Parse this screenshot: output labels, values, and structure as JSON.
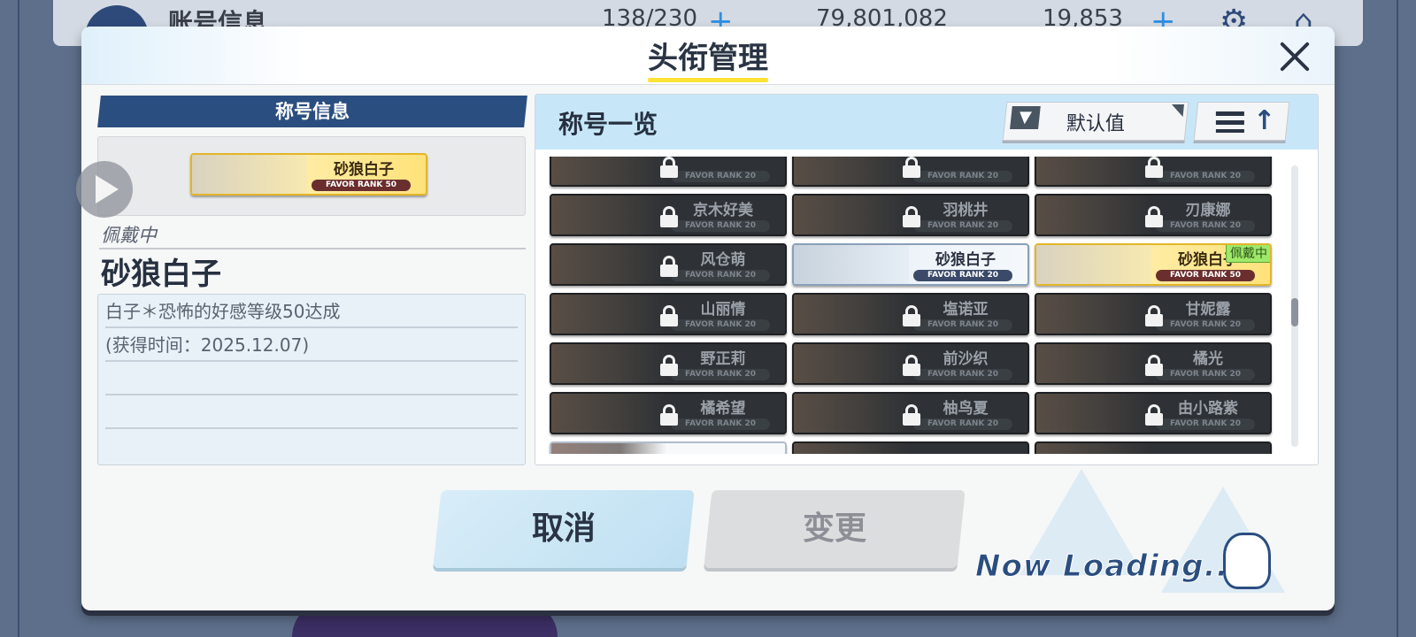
{
  "background": {
    "screen_title": "账号信息",
    "resources": [
      {
        "name": "ap",
        "value": "138/230"
      },
      {
        "name": "credits",
        "value": "79,801,082"
      },
      {
        "name": "gems",
        "value": "19,853"
      }
    ]
  },
  "modal": {
    "title": "头衔管理",
    "close_icon": "close-icon"
  },
  "left": {
    "header": "称号信息",
    "preview": {
      "name": "砂狼白子",
      "rank": "FAVOR RANK 50"
    },
    "equipped_label": "佩戴中",
    "equipped_name": "砂狼白子",
    "description_lines": [
      "白子＊恐怖的好感等级50达成",
      "(获得时间：2025.12.07)"
    ]
  },
  "right": {
    "title": "称号一览",
    "filter_label": "默认值",
    "equipped_badge": "佩戴中",
    "tiles": [
      {
        "name": "",
        "rank": "FAVOR RANK 20",
        "state": "locked"
      },
      {
        "name": "",
        "rank": "FAVOR RANK 20",
        "state": "locked"
      },
      {
        "name": "",
        "rank": "FAVOR RANK 20",
        "state": "locked"
      },
      {
        "name": "京木好美",
        "rank": "FAVOR RANK 20",
        "state": "locked"
      },
      {
        "name": "羽桃井",
        "rank": "FAVOR RANK 20",
        "state": "locked"
      },
      {
        "name": "刃康娜",
        "rank": "FAVOR RANK 20",
        "state": "locked"
      },
      {
        "name": "风仓萌",
        "rank": "FAVOR RANK 20",
        "state": "locked"
      },
      {
        "name": "砂狼白子",
        "rank": "FAVOR RANK 20",
        "state": "unlocked"
      },
      {
        "name": "砂狼白子",
        "rank": "FAVOR RANK 50",
        "state": "equipped"
      },
      {
        "name": "山丽情",
        "rank": "FAVOR RANK 20",
        "state": "locked"
      },
      {
        "name": "塩诺亚",
        "rank": "FAVOR RANK 20",
        "state": "locked"
      },
      {
        "name": "甘妮露",
        "rank": "FAVOR RANK 20",
        "state": "locked"
      },
      {
        "name": "野正莉",
        "rank": "FAVOR RANK 20",
        "state": "locked"
      },
      {
        "name": "前沙织",
        "rank": "FAVOR RANK 20",
        "state": "locked"
      },
      {
        "name": "橘光",
        "rank": "FAVOR RANK 20",
        "state": "locked"
      },
      {
        "name": "橘希望",
        "rank": "FAVOR RANK 20",
        "state": "locked"
      },
      {
        "name": "柚鸟夏",
        "rank": "FAVOR RANK 20",
        "state": "locked"
      },
      {
        "name": "由小路紫",
        "rank": "FAVOR RANK 20",
        "state": "locked"
      },
      {
        "name": "",
        "rank": "",
        "state": "pink"
      },
      {
        "name": "",
        "rank": "",
        "state": "locked"
      },
      {
        "name": "",
        "rank": "",
        "state": "locked"
      }
    ]
  },
  "buttons": {
    "cancel": "取消",
    "change": "变更"
  },
  "loading_text": "Now Loading...",
  "colors": {
    "accent_navy": "#2b4e80",
    "title_underline": "#ffe234",
    "equipped_badge": "#9ee86a",
    "panel_header": "#c7e7f9"
  }
}
